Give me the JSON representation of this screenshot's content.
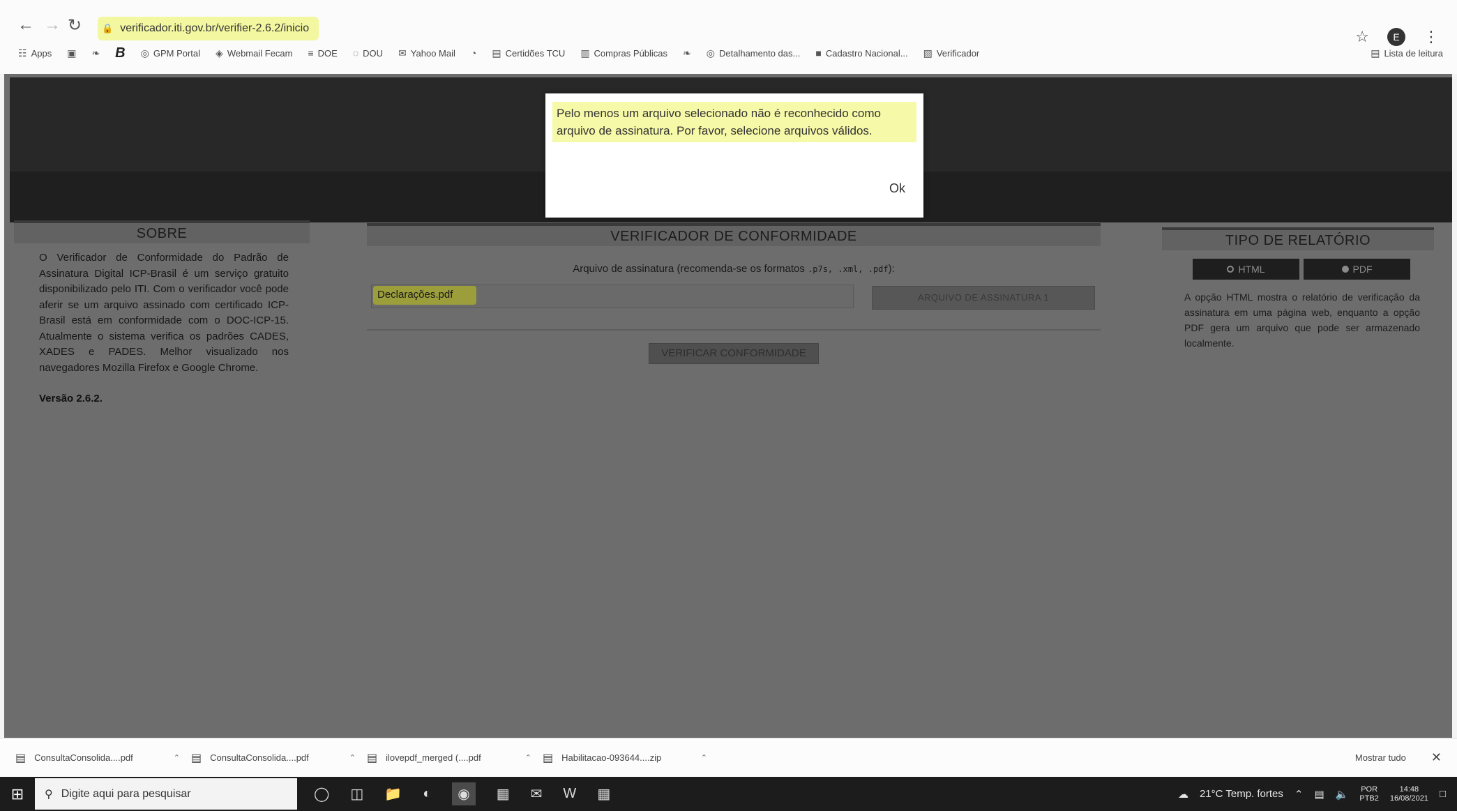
{
  "browser": {
    "url": "verificador.iti.gov.br/verifier-2.6.2/inicio",
    "bookmarks": [
      {
        "label": "Apps",
        "icon": "apps-grid-icon"
      },
      {
        "label": "",
        "icon": "bookmark-icon"
      },
      {
        "label": "",
        "icon": "bird-icon"
      },
      {
        "label": "B",
        "icon": "bold-b-icon"
      },
      {
        "label": "GPM Portal",
        "icon": "globe-icon"
      },
      {
        "label": "Webmail Fecam",
        "icon": "mail-icon"
      },
      {
        "label": "DOE",
        "icon": "doe-icon"
      },
      {
        "label": "DOU",
        "icon": "dou-icon"
      },
      {
        "label": "Yahoo Mail",
        "icon": "envelope-icon"
      },
      {
        "label": "",
        "icon": "whatsapp-icon"
      },
      {
        "label": "Certidões TCU",
        "icon": "document-icon"
      },
      {
        "label": "Compras Públicas",
        "icon": "cart-icon"
      },
      {
        "label": "",
        "icon": "bird-icon"
      },
      {
        "label": "Detalhamento das...",
        "icon": "globe-icon"
      },
      {
        "label": "Cadastro Nacional...",
        "icon": "cnj-icon"
      },
      {
        "label": "Verificador",
        "icon": "verificador-icon"
      }
    ],
    "reading_list": "Lista de leitura",
    "profile_initial": "E"
  },
  "page": {
    "about": {
      "title": "SOBRE",
      "text": "O Verificador de Conformidade do Padrão de Assinatura Digital ICP-Brasil é um serviço gratuito disponibilizado pelo ITI. Com o verificador você pode aferir se um arquivo assinado com certificado ICP-Brasil está em conformidade com o DOC-ICP-15. Atualmente o sistema verifica os padrões CADES, XADES e PADES. Melhor visualizado nos navegadores Mozilla Firefox e Google Chrome.",
      "version": "Versão 2.6.2."
    },
    "verifier": {
      "title": "VERIFICADOR DE CONFORMIDADE",
      "file_label": "Arquivo de assinatura (recomenda-se os formatos",
      "file_formats": ".p7s, .xml, .pdf",
      "file_label_end": "):",
      "file_value": "Declarações.pdf",
      "file_button": "ARQUIVO DE ASSINATURA 1",
      "verify_button": "VERIFICAR CONFORMIDADE"
    },
    "report": {
      "title": "TIPO DE RELATÓRIO",
      "options": [
        {
          "label": "HTML",
          "selected": false
        },
        {
          "label": "PDF",
          "selected": true
        }
      ],
      "text": "A opção HTML mostra o relatório de verificação da assinatura em uma página web, enquanto a opção PDF gera um arquivo que pode ser armazenado localmente."
    }
  },
  "modal": {
    "message": "Pelo menos um arquivo selecionado não é reconhecido como arquivo de assinatura. Por favor, selecione arquivos válidos.",
    "ok_label": "Ok"
  },
  "downloads": {
    "items": [
      {
        "name": "ConsultaConsolida....pdf"
      },
      {
        "name": "ConsultaConsolida....pdf"
      },
      {
        "name": "ilovepdf_merged (....pdf"
      },
      {
        "name": "Habilitacao-093644....zip"
      }
    ],
    "show_all": "Mostrar tudo"
  },
  "taskbar": {
    "search_placeholder": "Digite aqui para pesquisar",
    "weather": "21°C Temp. fortes",
    "lang_top": "POR",
    "lang_bottom": "PTB2",
    "time": "14:48",
    "date": "16/08/2021"
  }
}
